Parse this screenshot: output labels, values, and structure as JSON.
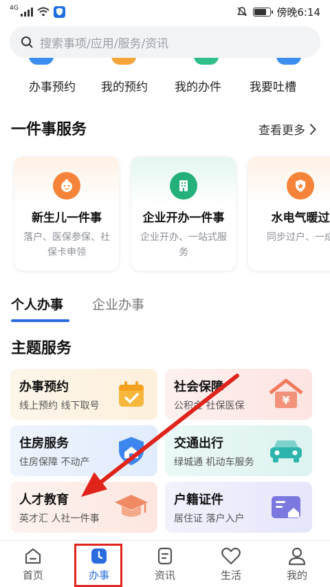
{
  "status_bar": {
    "network": "4G",
    "time": "傍晚6:14"
  },
  "search": {
    "placeholder": "搜索事项/应用/服务/资讯"
  },
  "quick_actions": [
    {
      "label": "办事预约",
      "color": "#3b8ef0"
    },
    {
      "label": "我的预约",
      "color": "#f5a53a"
    },
    {
      "label": "我的办件",
      "color": "#2fbf8a"
    },
    {
      "label": "我要吐槽",
      "color": "#3b8ef0"
    }
  ],
  "one_thing": {
    "title": "一件事服务",
    "see_more": "查看更多",
    "cards": [
      {
        "title": "新生儿一件事",
        "desc": "落户、医保参保、社保卡申领",
        "icon": "baby-icon",
        "color": "#f5843a",
        "bg": "#fff1e6"
      },
      {
        "title": "企业开办一件事",
        "desc": "企业开办、一站式服务",
        "icon": "building-icon",
        "color": "#24b07a",
        "bg": "#e4f7ef"
      },
      {
        "title": "水电气暖过",
        "desc": "同步过户、一成",
        "icon": "badge-icon",
        "color": "#f5843a",
        "bg": "#fff1e6"
      }
    ]
  },
  "tabs": [
    {
      "label": "个人办事",
      "active": true
    },
    {
      "label": "企业办事",
      "active": false
    }
  ],
  "themes": {
    "title": "主题服务",
    "items": [
      {
        "title": "办事预约",
        "sub": "线上预约 线下取号",
        "icon": "calendar-icon",
        "bg": "#fdf3e1",
        "accent": "#f7b73c"
      },
      {
        "title": "社会保障",
        "sub": "公积金 社保医保",
        "icon": "house-yen-icon",
        "bg": "#fdeceb",
        "accent": "#f07a5a"
      },
      {
        "title": "住房服务",
        "sub": "住房保障 不动产",
        "icon": "home-shield-icon",
        "bg": "#e8f1fd",
        "accent": "#3d86ee"
      },
      {
        "title": "交通出行",
        "sub": "绿城通 机动车服务",
        "icon": "car-icon",
        "bg": "#e4f6f4",
        "accent": "#2db5ad"
      },
      {
        "title": "人才教育",
        "sub": "英才汇 人社一件事",
        "icon": "graduation-cap-icon",
        "bg": "#fdeeea",
        "accent": "#f08a64"
      },
      {
        "title": "户籍证件",
        "sub": "居住证 落户入户",
        "icon": "id-card-icon",
        "bg": "#eeeefc",
        "accent": "#7b78e0"
      }
    ]
  },
  "nav": {
    "items": [
      {
        "label": "首页",
        "icon": "home-icon",
        "active": false
      },
      {
        "label": "办事",
        "icon": "clock-icon",
        "active": true
      },
      {
        "label": "资讯",
        "icon": "news-icon",
        "active": false
      },
      {
        "label": "生活",
        "icon": "heart-icon",
        "active": false
      },
      {
        "label": "我的",
        "icon": "user-icon",
        "active": false
      }
    ]
  },
  "colors": {
    "accent_blue": "#2a6ce0",
    "annotation_red": "#e0241b"
  }
}
